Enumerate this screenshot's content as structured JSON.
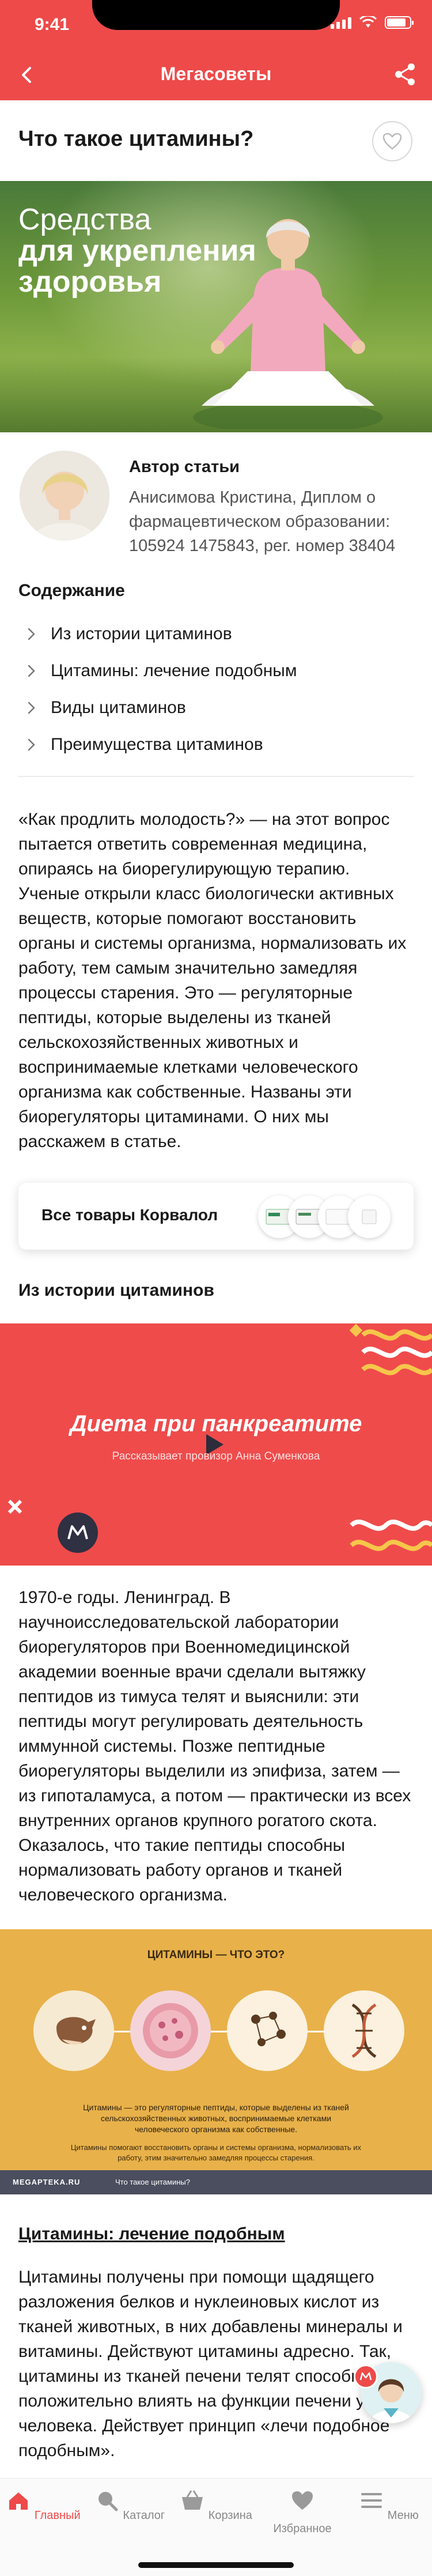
{
  "status": {
    "time": "9:41"
  },
  "nav": {
    "title": "Мегасоветы"
  },
  "article": {
    "title": "Что такое цитамины?",
    "hero": {
      "line1": "Средства",
      "line2": "для укрепления",
      "line3": "здоровья"
    }
  },
  "author": {
    "label": "Автор статьи",
    "info": "Анисимова Кристина, Диплом о фармацевтическом образовании: 105924 1475843, рег. номер  38404"
  },
  "toc": {
    "title": "Содержание",
    "items": [
      "Из истории цитаминов",
      "Цитамины: лечение подобным",
      "Виды цитаминов",
      "Преимущества цитаминов"
    ]
  },
  "body": {
    "p1": "«Как продлить молодость?» — на этот вопрос пытается ответить современная медицина, опираясь на биорегулирующую терапию. Ученые открыли класс биологически активных веществ, которые помогают восстановить органы и системы организма, нормализовать их работу, тем самым значительно замедляя процессы старения. Это — регуляторные пептиды, которые выделены из тканей сельскохозяйственных животных и воспринимаемые клетками человеческого организма как собственные. Названы эти биорегуляторы цитаминами. О них мы расскажем в статье.",
    "section1": "Из истории цитаминов",
    "p2": "1970-е годы. Ленинград. В научноисследовательской лаборатории биорегуляторов при Военномедицинской академии военные врачи сделали вытяжку пептидов из тимуса телят и выяснили: эти пептиды могут регулировать деятельность иммунной системы. Позже пептидные биорегуляторы выделили из эпифиза, затем — из гипоталамуса, а потом — практически из всех внутренних органов крупного рогатого скота. Оказалось, что такие пептиды способны нормализовать работу органов и тканей человеческого организма.",
    "section2": "Цитамины: лечение подобным",
    "p3": "Цитамины получены при помощи щадящего разложения белков и нуклеиновых кислот из тканей животных, в них добавлены минералы и витамины. Действуют цитамины адресно. Так, цитамины из тканей печени телят способны положительно влиять на функции печени у человека. Действует принцип «лечи подобное подобным»."
  },
  "promo": {
    "label": "Все товары Корвалол"
  },
  "video": {
    "title": "Диета при панкреатите",
    "subtitle": "Рассказывает провизор Анна Суменкова"
  },
  "infographic": {
    "title": "ЦИТАМИНЫ — ЧТО ЭТО?",
    "caption1": "Цитамины — это регуляторные пептиды, которые выделены из тканей сельскохозяйственных животных, воспринимаемые клетками человеческого организма как собственные.",
    "caption2": "Цитамины помогают восстановить органы и системы организма, нормализовать их работу, этим значительно замедляя процессы старения.",
    "brand": "MEGAPTEKA.RU",
    "footer_text": "Что такое цитамины?"
  },
  "tabs": [
    {
      "label": "Главный",
      "icon": "home-icon",
      "active": true
    },
    {
      "label": "Каталог",
      "icon": "search-icon",
      "active": false
    },
    {
      "label": "Корзина",
      "icon": "basket-icon",
      "active": false
    },
    {
      "label": "Избранное",
      "icon": "heart-icon",
      "active": false
    },
    {
      "label": "Меню",
      "icon": "menu-icon",
      "active": false
    }
  ],
  "colors": {
    "accent": "#ee4a4a",
    "infographic_bg": "#e8b14a",
    "video_bg": "#ef4b4b"
  }
}
